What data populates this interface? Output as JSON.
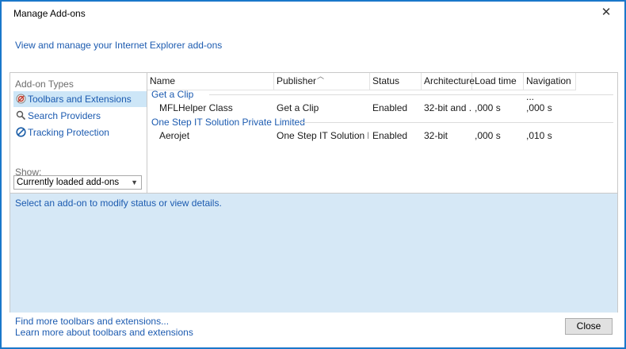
{
  "window": {
    "title": "Manage Add-ons",
    "close_glyph": "✕"
  },
  "header": {
    "link": "View and manage your Internet Explorer add-ons"
  },
  "sidebar": {
    "heading": "Add-on Types",
    "items": [
      {
        "label": "Toolbars and Extensions",
        "icon": "toolbars-extensions-icon",
        "selected": true
      },
      {
        "label": "Search Providers",
        "icon": "search-icon",
        "selected": false
      },
      {
        "label": "Tracking Protection",
        "icon": "tracking-protection-icon",
        "selected": false
      }
    ],
    "show_label": "Show:",
    "show_value": "Currently loaded add-ons"
  },
  "columns": [
    "Name",
    "Publisher",
    "Status",
    "Architecture",
    "Load time",
    "Navigation ..."
  ],
  "groups": [
    {
      "name": "Get a Clip",
      "rows": [
        {
          "name": "MFLHelper Class",
          "publisher": "Get a Clip",
          "status": "Enabled",
          "architecture": "32-bit and ...",
          "load_time": ",000 s",
          "navigation": ",000 s"
        }
      ]
    },
    {
      "name": "One Step IT Solution Private Limited",
      "rows": [
        {
          "name": "Aerojet",
          "publisher": "One Step IT Solution Priv...",
          "status": "Enabled",
          "architecture": "32-bit",
          "load_time": ",000 s",
          "navigation": ",010 s"
        }
      ]
    }
  ],
  "details": {
    "status_text": "Select an add-on to modify status or view details."
  },
  "footer": {
    "link1": "Find more toolbars and extensions...",
    "link2": "Learn more about toolbars and extensions",
    "close_button": "Close"
  },
  "colors": {
    "accent": "#1979ca",
    "link": "#1c5bb0",
    "selection": "#cde6f7",
    "details_bg": "#d6e8f6"
  }
}
